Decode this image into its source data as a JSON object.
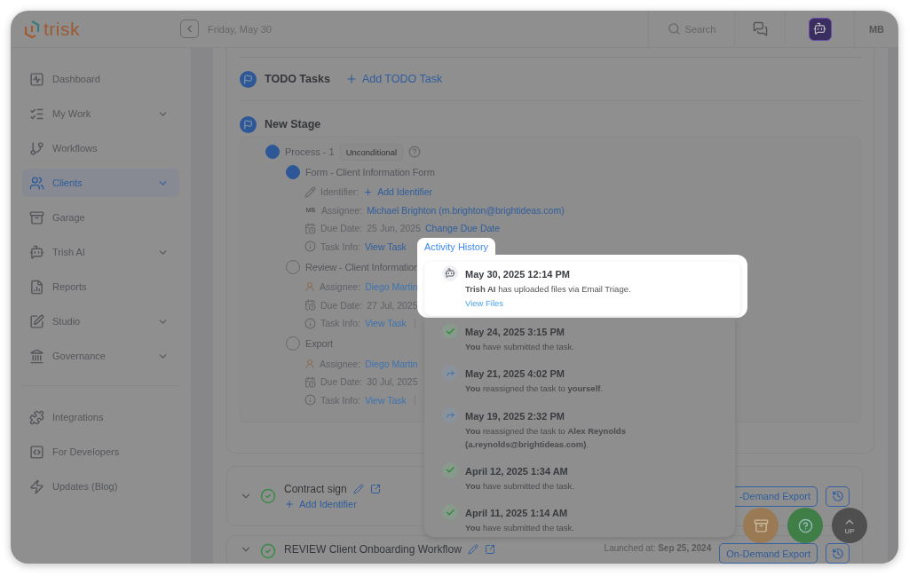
{
  "topbar": {
    "logo": "trisk",
    "date": "Friday, May 30",
    "search": {
      "placeholder": "Search"
    },
    "user_initials": "MB"
  },
  "sidebar": {
    "items": [
      {
        "label": "Dashboard",
        "selected": false,
        "expandable": false
      },
      {
        "label": "My Work",
        "selected": false,
        "expandable": true
      },
      {
        "label": "Workflows",
        "selected": false,
        "expandable": false
      },
      {
        "label": "Clients",
        "selected": true,
        "expandable": true
      },
      {
        "label": "Garage",
        "selected": false,
        "expandable": false
      },
      {
        "label": "Trish AI",
        "selected": false,
        "expandable": true
      },
      {
        "label": "Reports",
        "selected": false,
        "expandable": false
      },
      {
        "label": "Studio",
        "selected": false,
        "expandable": true
      },
      {
        "label": "Governance",
        "selected": false,
        "expandable": true
      }
    ],
    "footer_items": [
      {
        "label": "Integrations"
      },
      {
        "label": "For Developers"
      },
      {
        "label": "Updates (Blog)"
      }
    ]
  },
  "todo": {
    "title": "TODO Tasks",
    "action": "Add TODO Task"
  },
  "stage": {
    "title": "New Stage",
    "process": {
      "title": "Process - 1",
      "badge": "Unconditional"
    },
    "tasks": [
      {
        "title": "Form - Client Information Form",
        "active": true,
        "fields": [
          {
            "kind": "identifier",
            "label": "Identifier:",
            "link": "Add Identifier"
          },
          {
            "kind": "assignee",
            "label": "Assignee:",
            "avatar": "MB",
            "link": "Michael Brighton (m.brighton@brightideas.com)"
          },
          {
            "kind": "due",
            "label": "Due Date:",
            "value": "25 Jun, 2025",
            "link": "Change Due Date"
          },
          {
            "kind": "info",
            "label": "Task Info:",
            "link": "View Task",
            "separator": false
          }
        ]
      },
      {
        "title": "Review - Client Information",
        "active": false,
        "fields": [
          {
            "kind": "assignee",
            "label": "Assignee:",
            "link": "Diego Martin"
          },
          {
            "kind": "due",
            "label": "Due Date:",
            "value": "27 Jul, 2025"
          },
          {
            "kind": "info",
            "label": "Task Info:",
            "link": "View Task",
            "separator": true
          }
        ]
      },
      {
        "title": "Export",
        "active": false,
        "fields": [
          {
            "kind": "assignee",
            "label": "Assignee:",
            "link": "Diego Martin"
          },
          {
            "kind": "due",
            "label": "Due Date:",
            "value": "30 Jul, 2025"
          },
          {
            "kind": "info",
            "label": "Task Info:",
            "link": "View Task",
            "separator": true
          }
        ]
      }
    ]
  },
  "workflows": [
    {
      "title": "Contract sign",
      "identifier_action": "Add Identifier",
      "export_button": "-Demand Export"
    },
    {
      "title": "REVIEW Client Onboarding Workflow",
      "launched_label": "Launched at:",
      "launched_date": "Sep 25, 2024",
      "export_button": "On-Demand Export"
    }
  ],
  "activity_history": {
    "tab": "Activity History",
    "items": [
      {
        "kind": "ai",
        "highlighted": true,
        "date": "May 30, 2025 12:14 PM",
        "text": "**Trish AI** has uploaded files via Email Triage.",
        "link": "View Files"
      },
      {
        "kind": "submitted",
        "highlighted": false,
        "date": "May 24, 2025 3:15 PM",
        "text": "**You** have submitted the task."
      },
      {
        "kind": "reassigned",
        "highlighted": false,
        "date": "May 21, 2025 4:02 PM",
        "text": "**You** reassigned the task to **yourself**."
      },
      {
        "kind": "reassigned",
        "highlighted": false,
        "date": "May 19, 2025 2:32 PM",
        "text": "**You** reassigned the task to **Alex Reynolds (a.reynolds@brightideas.com)**."
      },
      {
        "kind": "submitted",
        "highlighted": false,
        "date": "April 12, 2025 1:34 AM",
        "text": "**You** have submitted the task."
      },
      {
        "kind": "submitted",
        "highlighted": false,
        "date": "April 11, 2025 1:14 AM",
        "text": "**You** have submitted the task."
      }
    ]
  },
  "floating_buttons": {
    "up_label": "UP"
  }
}
